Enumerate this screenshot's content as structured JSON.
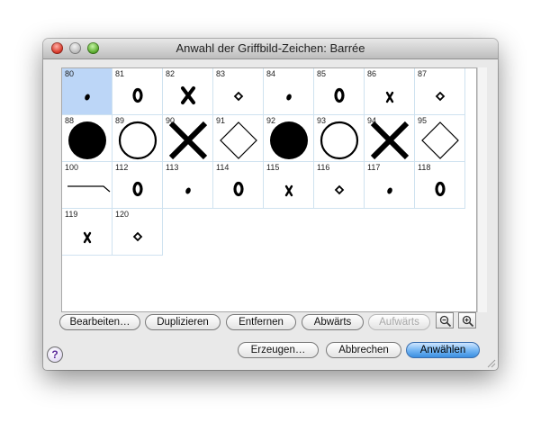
{
  "window": {
    "title": "Anwahl der Griffbild-Zeichen: Barrée"
  },
  "grid": {
    "selected_index": 0,
    "cells": [
      {
        "num": "80",
        "icon": "small-dot-icon"
      },
      {
        "num": "81",
        "icon": "small-ring-icon"
      },
      {
        "num": "82",
        "icon": "small-x-icon"
      },
      {
        "num": "83",
        "icon": "small-diamond-icon"
      },
      {
        "num": "84",
        "icon": "small-dot-icon"
      },
      {
        "num": "85",
        "icon": "small-ring-icon"
      },
      {
        "num": "86",
        "icon": "tiny-x-icon"
      },
      {
        "num": "87",
        "icon": "small-diamond-icon"
      },
      {
        "num": "88",
        "icon": "large-filled-circle-icon"
      },
      {
        "num": "89",
        "icon": "large-open-circle-icon"
      },
      {
        "num": "90",
        "icon": "large-x-icon"
      },
      {
        "num": "91",
        "icon": "large-diamond-icon"
      },
      {
        "num": "92",
        "icon": "large-filled-circle-icon"
      },
      {
        "num": "93",
        "icon": "large-open-circle-icon"
      },
      {
        "num": "94",
        "icon": "large-x-icon"
      },
      {
        "num": "95",
        "icon": "large-diamond-icon"
      },
      {
        "num": "100",
        "icon": "barre-line-icon"
      },
      {
        "num": "112",
        "icon": "small-ring-icon"
      },
      {
        "num": "113",
        "icon": "small-dot-icon"
      },
      {
        "num": "114",
        "icon": "small-ring-icon"
      },
      {
        "num": "115",
        "icon": "tiny-x-icon"
      },
      {
        "num": "116",
        "icon": "small-diamond-icon"
      },
      {
        "num": "117",
        "icon": "small-dot-icon"
      },
      {
        "num": "118",
        "icon": "small-ring-icon"
      },
      {
        "num": "119",
        "icon": "tiny-x-icon"
      },
      {
        "num": "120",
        "icon": "small-diamond-icon"
      }
    ]
  },
  "toolbar": {
    "edit_label": "Bearbeiten…",
    "duplicate_label": "Duplizieren",
    "remove_label": "Entfernen",
    "down_label": "Abwärts",
    "up_label": "Aufwärts",
    "zoom_out_icon": "zoom-out-icon",
    "zoom_in_icon": "zoom-in-icon"
  },
  "footer": {
    "help_label": "?",
    "create_label": "Erzeugen…",
    "cancel_label": "Abbrechen",
    "select_label": "Anwählen"
  },
  "colors": {
    "selected_cell": "#bcd6f7",
    "primary_button": "#6fb3f2",
    "help_glyph": "#5b2a9b"
  }
}
